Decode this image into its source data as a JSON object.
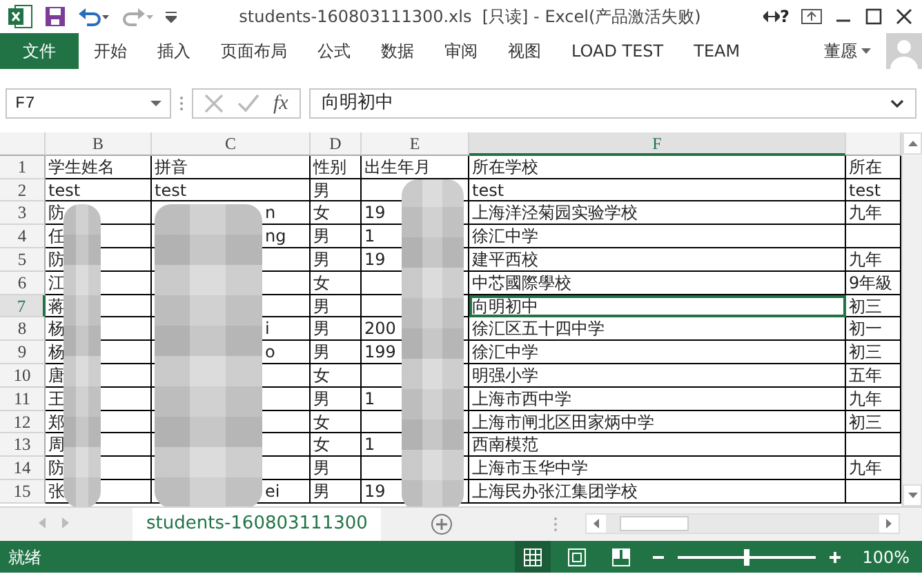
{
  "title_bar": {
    "title": "students-160803111300.xls  [只读] - Excel(产品激活失败)",
    "help": "?"
  },
  "ribbon_tabs": [
    {
      "label": "文件",
      "kind": "file",
      "selected": false
    },
    {
      "label": "开始",
      "kind": "tab",
      "selected": false
    },
    {
      "label": "插入",
      "kind": "tab",
      "selected": false
    },
    {
      "label": "页面布局",
      "kind": "tab",
      "selected": false
    },
    {
      "label": "公式",
      "kind": "tab",
      "selected": false
    },
    {
      "label": "数据",
      "kind": "tab",
      "selected": false
    },
    {
      "label": "审阅",
      "kind": "tab",
      "selected": false
    },
    {
      "label": "视图",
      "kind": "tab",
      "selected": false
    },
    {
      "label": "LOAD TEST",
      "kind": "tab",
      "selected": false
    },
    {
      "label": "TEAM",
      "kind": "tab",
      "selected": false
    }
  ],
  "user": {
    "name": "董愿"
  },
  "formula_bar": {
    "name_box": "F7",
    "function_label": "fx",
    "formula": "向明初中"
  },
  "sheet": {
    "columns": [
      {
        "label": "B",
        "selected": false
      },
      {
        "label": "C",
        "selected": false
      },
      {
        "label": "D",
        "selected": false
      },
      {
        "label": "E",
        "selected": false
      },
      {
        "label": "F",
        "selected": true
      },
      {
        "selected": false
      }
    ],
    "rows": [
      {
        "number": "1",
        "selected": false,
        "cells": [
          "学生姓名",
          "拼音",
          "性别",
          "出生年月",
          "所在学校",
          "所在"
        ]
      },
      {
        "number": "2",
        "selected": false,
        "cells": [
          "test",
          "test",
          "男",
          null,
          "test",
          "test"
        ]
      },
      {
        "number": "3",
        "selected": false,
        "cells": [
          "防",
          "n",
          "女",
          "19",
          "上海洋泾菊园实验学校",
          "九年"
        ]
      },
      {
        "number": "4",
        "selected": false,
        "cells": [
          "任",
          "ng",
          "男",
          "1",
          "徐汇中学",
          null
        ]
      },
      {
        "number": "5",
        "selected": false,
        "cells": [
          "防",
          null,
          "男",
          "19",
          "建平西校",
          "九年"
        ]
      },
      {
        "number": "6",
        "selected": false,
        "cells": [
          "江",
          null,
          "女",
          null,
          "中芯國際學校",
          "9年級"
        ]
      },
      {
        "number": "7",
        "selected": true,
        "cells": [
          "蒋",
          null,
          "男",
          null,
          "向明初中",
          "初三"
        ]
      },
      {
        "number": "8",
        "selected": false,
        "cells": [
          "杨",
          "i",
          "男",
          "200",
          "徐汇区五十四中学",
          "初一"
        ]
      },
      {
        "number": "9",
        "selected": false,
        "cells": [
          "杨",
          "o",
          "男",
          "199",
          "徐汇中学",
          "初三"
        ]
      },
      {
        "number": "10",
        "selected": false,
        "cells": [
          "唐",
          null,
          "女",
          null,
          "明强小学",
          "五年"
        ]
      },
      {
        "number": "11",
        "selected": false,
        "cells": [
          "王",
          null,
          "男",
          "1",
          "上海市西中学",
          "九年"
        ]
      },
      {
        "number": "12",
        "selected": false,
        "cells": [
          "郑",
          null,
          "女",
          null,
          "上海市闸北区田家炳中学",
          "初三"
        ]
      },
      {
        "number": "13",
        "selected": false,
        "cells": [
          "周",
          null,
          "女",
          "1",
          "西南模范",
          null
        ]
      },
      {
        "number": "14",
        "selected": false,
        "cells": [
          "防",
          null,
          "男",
          null,
          "上海市玉华中学",
          "九年"
        ]
      },
      {
        "number": "15",
        "selected": false,
        "cells": [
          "张",
          "ei",
          "男",
          "19",
          "上海民办张江集团学校",
          null
        ]
      }
    ]
  },
  "sheet_tabs": [
    {
      "label": "students-160803111300",
      "selected": true
    }
  ],
  "status_bar": {
    "status": "就绪",
    "views": [
      {
        "kind": "normal",
        "selected": true
      },
      {
        "kind": "page-layout",
        "selected": false
      },
      {
        "kind": "page-break",
        "selected": false
      }
    ],
    "zoom_slider": {
      "level": 0.5
    },
    "zoom": "100%"
  }
}
